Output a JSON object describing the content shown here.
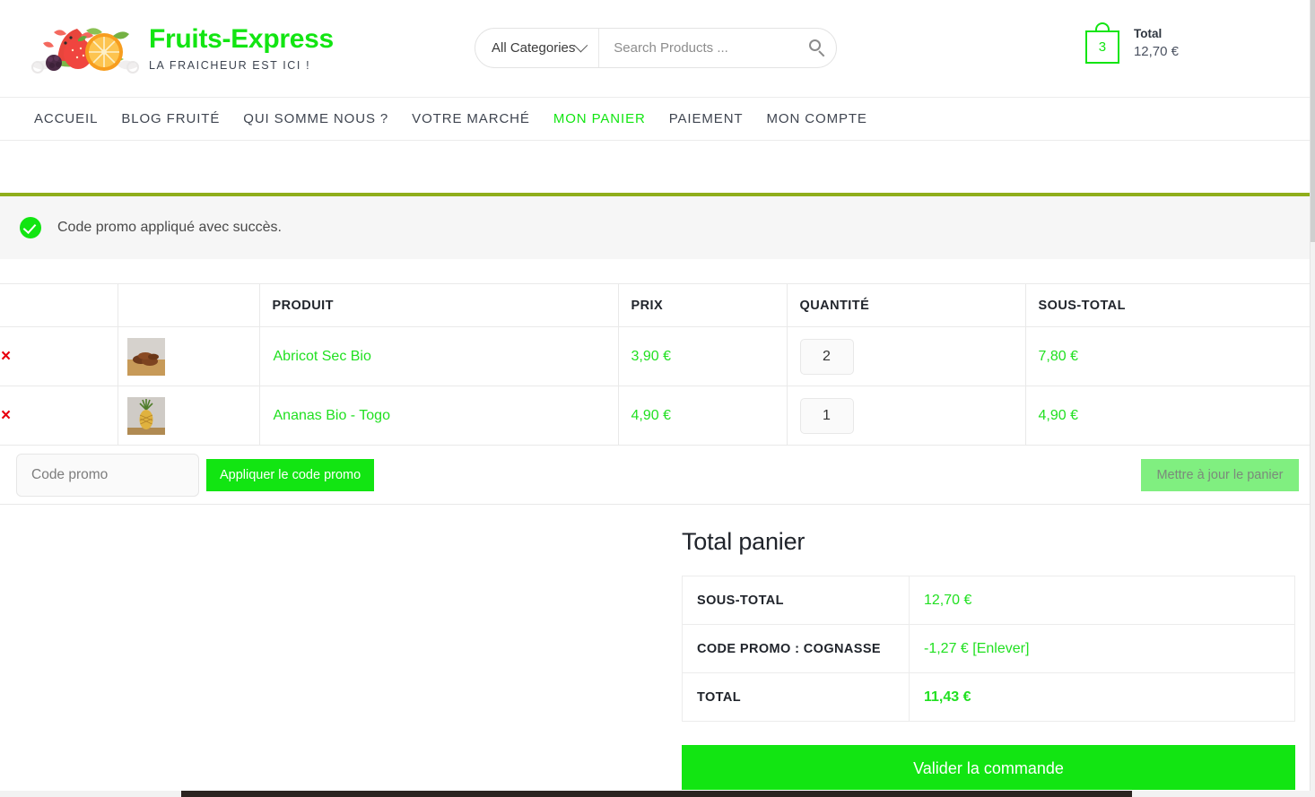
{
  "header": {
    "brand_name": "Fruits-Express",
    "tagline": "LA FRAICHEUR EST ICI !",
    "logo_icon": "fruit-basket-logo",
    "search": {
      "category_selected": "All Categories",
      "category_icon": "chevron-down-icon",
      "placeholder": "Search Products ...",
      "value": "",
      "search_icon": "search-icon"
    },
    "cart": {
      "icon": "shopping-bag-icon",
      "count": "3",
      "label": "Total",
      "amount": "12,70 €"
    }
  },
  "nav": {
    "items": [
      {
        "label": "ACCUEIL",
        "active": false
      },
      {
        "label": "BLOG FRUITÉ",
        "active": false
      },
      {
        "label": "QUI SOMME NOUS ?",
        "active": false
      },
      {
        "label": "VOTRE MARCHÉ",
        "active": false
      },
      {
        "label": "MON PANIER",
        "active": true
      },
      {
        "label": "PAIEMENT",
        "active": false
      },
      {
        "label": "MON COMPTE",
        "active": false
      }
    ]
  },
  "notice": {
    "icon": "success-check-icon",
    "message": "Code promo appliqué avec succès.",
    "accent_color": "#8fae1b"
  },
  "cart_table": {
    "headers": {
      "remove": "",
      "thumbnail": "",
      "product": "PRODUIT",
      "price": "PRIX",
      "quantity": "QUANTITÉ",
      "subtotal": "SOUS-TOTAL"
    },
    "rows": [
      {
        "remove_icon": "remove-x-icon",
        "remove_label": "×",
        "thumbnail_icon": "product-thumbnail-abricot",
        "product": "Abricot Sec Bio",
        "price": "3,90 €",
        "quantity": "2",
        "subtotal": "7,80 €"
      },
      {
        "remove_icon": "remove-x-icon",
        "remove_label": "×",
        "thumbnail_icon": "product-thumbnail-ananas",
        "product": "Ananas Bio - Togo",
        "price": "4,90 €",
        "quantity": "1",
        "subtotal": "4,90 €"
      }
    ],
    "coupon": {
      "placeholder": "Code promo",
      "value": "",
      "apply_label": "Appliquer le code promo",
      "update_label": "Mettre à jour le panier",
      "update_disabled": true
    }
  },
  "totals": {
    "title": "Total panier",
    "rows": [
      {
        "label": "SOUS-TOTAL",
        "value": "12,70 €",
        "remove_label": ""
      },
      {
        "label": "CODE PROMO : COGNASSE",
        "value": "-1,27 €",
        "remove_label": "[Enlever]"
      },
      {
        "label": "TOTAL",
        "value": "11,43 €",
        "remove_label": ""
      }
    ],
    "checkout_label": "Valider la commande"
  },
  "colors": {
    "brand_green": "#12e512",
    "link_green": "#21e021",
    "notice_accent": "#8fae1b",
    "remove_red": "#e8000d",
    "disabled_green": "#80ef80"
  }
}
